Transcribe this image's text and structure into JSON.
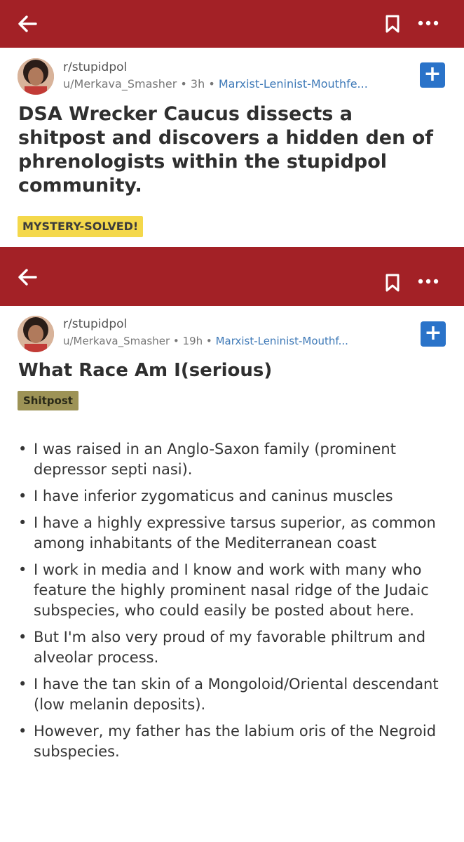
{
  "header_top": {
    "back_icon": "arrow-left-icon",
    "bookmark_icon": "bookmark-icon",
    "more_icon": "more-horizontal-icon",
    "bar_color": "#a32126"
  },
  "post1": {
    "subreddit": "r/stupidpol",
    "user": "u/Merkava_Smasher",
    "time": "3h",
    "flair": "Marxist-Leninist-Mouthfe...",
    "separator": "•",
    "title": "DSA Wrecker Caucus dissects a shitpost and discovers a hidden den of phrenologists within the stupidpol community.",
    "tag": "MYSTERY-SOLVED!",
    "tag_color": "#f4d84b"
  },
  "header_embedded": {
    "back_icon": "arrow-left-icon",
    "bookmark_icon": "bookmark-icon",
    "more_icon": "more-horizontal-icon"
  },
  "post2": {
    "subreddit": "r/stupidpol",
    "user": "u/Merkava_Smasher",
    "time": "19h",
    "flair": "Marxist-Leninist-Mouthf...",
    "separator": "•",
    "title": "What Race Am I(serious)",
    "tag": "Shitpost",
    "tag_color": "#9d9356",
    "bullets": [
      "I was raised in an Anglo-Saxon family (prominent depressor septi nasi).",
      "I have inferior zygomaticus and caninus muscles",
      "I have a highly expressive tarsus superior, as common among inhabitants of the Mediterranean coast",
      "I work in media and I know and work with many who feature the highly prominent nasal ridge of the Judaic subspecies, who could easily be posted about here.",
      "But I'm also very proud of my favorable philtrum and alveolar process.",
      "I have the tan skin of a Mongoloid/Oriental descendant (low melanin deposits).",
      "However, my father has the labium oris of the Negroid subspecies."
    ],
    "bullet_char": "•"
  },
  "plus_label": "+"
}
